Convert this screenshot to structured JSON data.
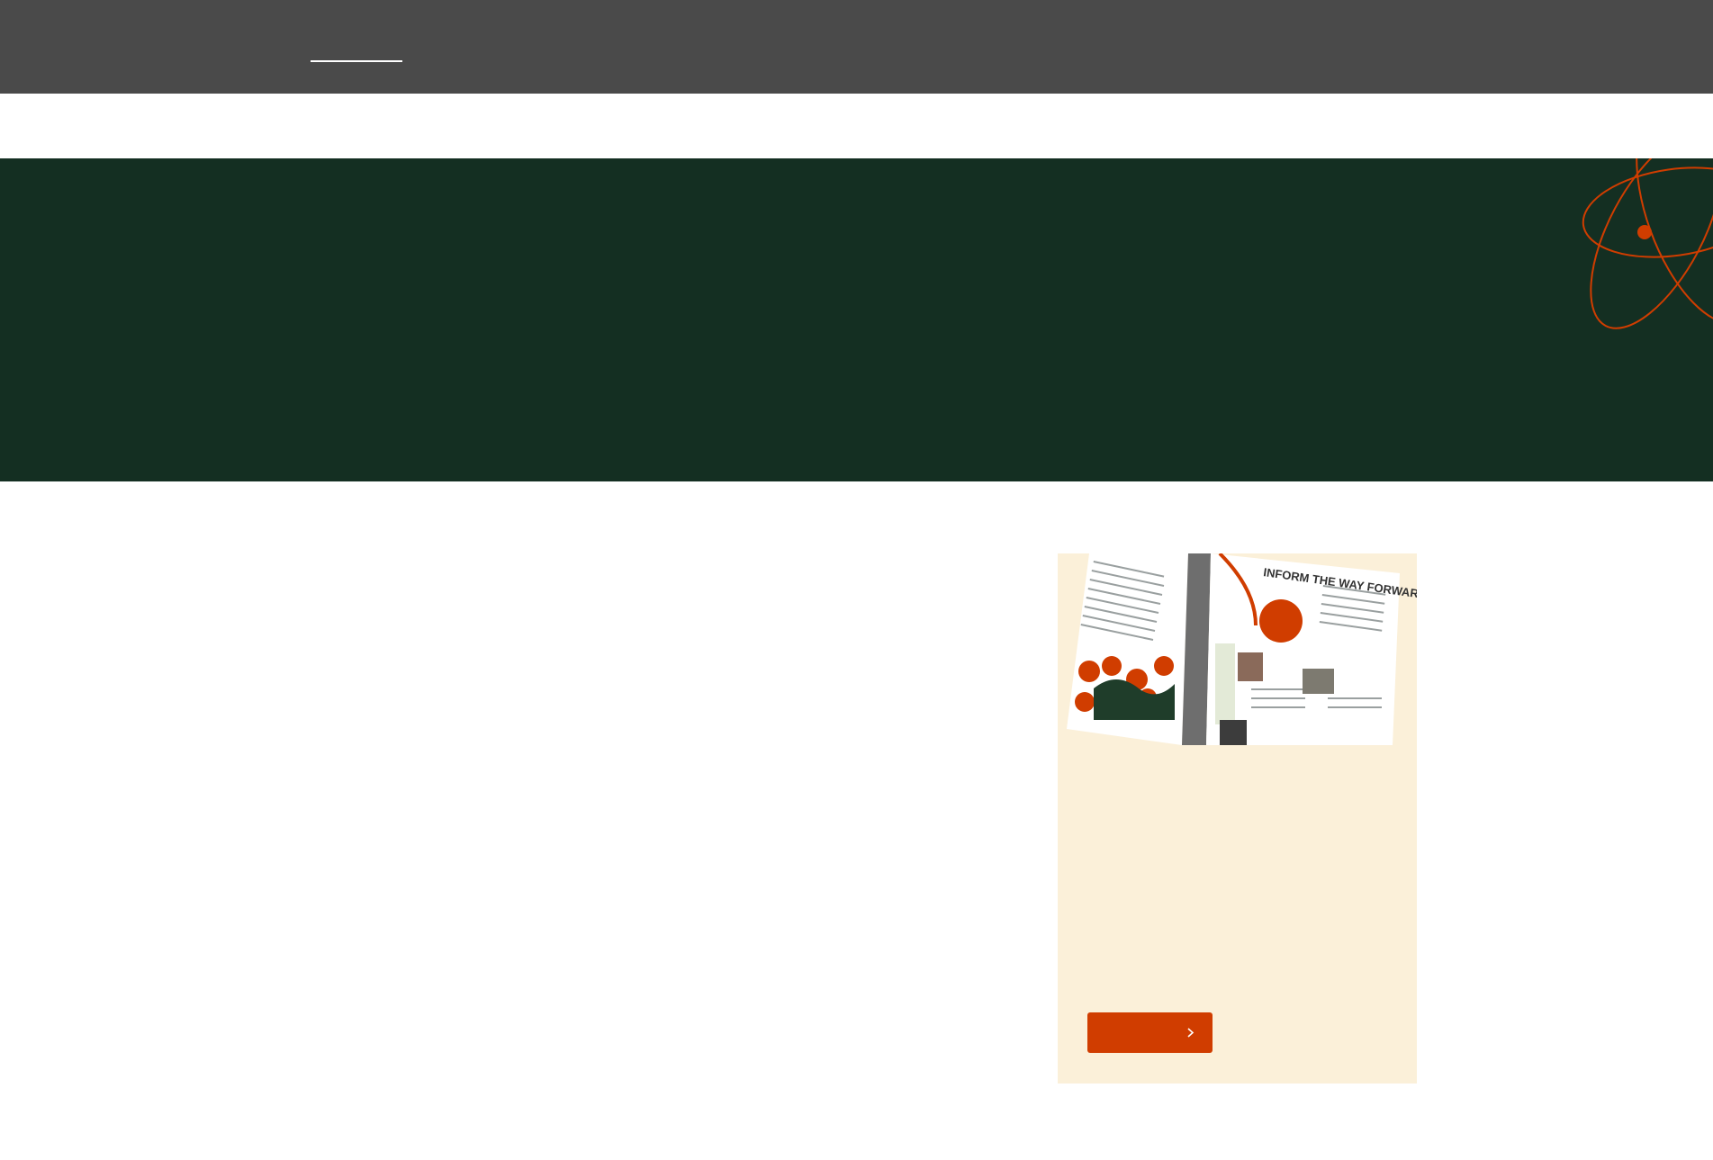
{
  "header": {
    "nav_active_label": ""
  },
  "hero": {
    "title": ""
  },
  "card": {
    "image_headline": "INFORM THE WAY FORWARD",
    "text": "",
    "button_label": ""
  },
  "colors": {
    "topbar": "#4a4a4a",
    "hero_bg": "#142f22",
    "accent": "#d03d00",
    "card_bg": "#fbf0d9"
  }
}
